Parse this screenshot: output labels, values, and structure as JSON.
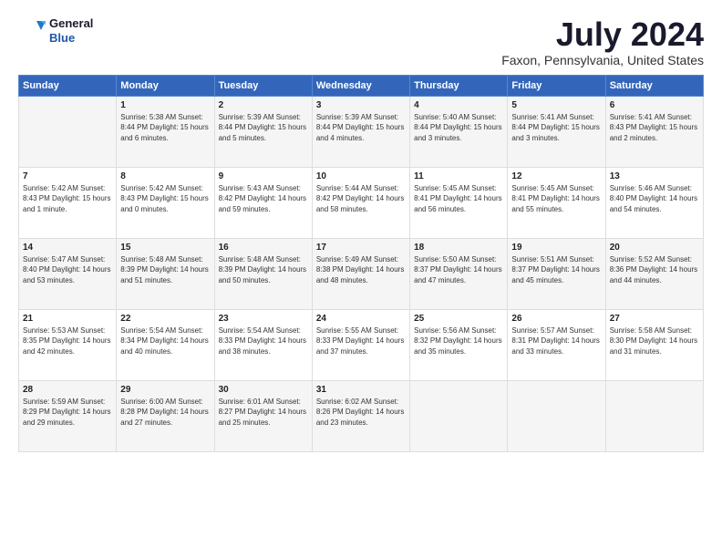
{
  "header": {
    "logo_general": "General",
    "logo_blue": "Blue",
    "month": "July 2024",
    "location": "Faxon, Pennsylvania, United States"
  },
  "days_of_week": [
    "Sunday",
    "Monday",
    "Tuesday",
    "Wednesday",
    "Thursday",
    "Friday",
    "Saturday"
  ],
  "weeks": [
    [
      {
        "day": "",
        "content": ""
      },
      {
        "day": "1",
        "content": "Sunrise: 5:38 AM\nSunset: 8:44 PM\nDaylight: 15 hours\nand 6 minutes."
      },
      {
        "day": "2",
        "content": "Sunrise: 5:39 AM\nSunset: 8:44 PM\nDaylight: 15 hours\nand 5 minutes."
      },
      {
        "day": "3",
        "content": "Sunrise: 5:39 AM\nSunset: 8:44 PM\nDaylight: 15 hours\nand 4 minutes."
      },
      {
        "day": "4",
        "content": "Sunrise: 5:40 AM\nSunset: 8:44 PM\nDaylight: 15 hours\nand 3 minutes."
      },
      {
        "day": "5",
        "content": "Sunrise: 5:41 AM\nSunset: 8:44 PM\nDaylight: 15 hours\nand 3 minutes."
      },
      {
        "day": "6",
        "content": "Sunrise: 5:41 AM\nSunset: 8:43 PM\nDaylight: 15 hours\nand 2 minutes."
      }
    ],
    [
      {
        "day": "7",
        "content": "Sunrise: 5:42 AM\nSunset: 8:43 PM\nDaylight: 15 hours\nand 1 minute."
      },
      {
        "day": "8",
        "content": "Sunrise: 5:42 AM\nSunset: 8:43 PM\nDaylight: 15 hours\nand 0 minutes."
      },
      {
        "day": "9",
        "content": "Sunrise: 5:43 AM\nSunset: 8:42 PM\nDaylight: 14 hours\nand 59 minutes."
      },
      {
        "day": "10",
        "content": "Sunrise: 5:44 AM\nSunset: 8:42 PM\nDaylight: 14 hours\nand 58 minutes."
      },
      {
        "day": "11",
        "content": "Sunrise: 5:45 AM\nSunset: 8:41 PM\nDaylight: 14 hours\nand 56 minutes."
      },
      {
        "day": "12",
        "content": "Sunrise: 5:45 AM\nSunset: 8:41 PM\nDaylight: 14 hours\nand 55 minutes."
      },
      {
        "day": "13",
        "content": "Sunrise: 5:46 AM\nSunset: 8:40 PM\nDaylight: 14 hours\nand 54 minutes."
      }
    ],
    [
      {
        "day": "14",
        "content": "Sunrise: 5:47 AM\nSunset: 8:40 PM\nDaylight: 14 hours\nand 53 minutes."
      },
      {
        "day": "15",
        "content": "Sunrise: 5:48 AM\nSunset: 8:39 PM\nDaylight: 14 hours\nand 51 minutes."
      },
      {
        "day": "16",
        "content": "Sunrise: 5:48 AM\nSunset: 8:39 PM\nDaylight: 14 hours\nand 50 minutes."
      },
      {
        "day": "17",
        "content": "Sunrise: 5:49 AM\nSunset: 8:38 PM\nDaylight: 14 hours\nand 48 minutes."
      },
      {
        "day": "18",
        "content": "Sunrise: 5:50 AM\nSunset: 8:37 PM\nDaylight: 14 hours\nand 47 minutes."
      },
      {
        "day": "19",
        "content": "Sunrise: 5:51 AM\nSunset: 8:37 PM\nDaylight: 14 hours\nand 45 minutes."
      },
      {
        "day": "20",
        "content": "Sunrise: 5:52 AM\nSunset: 8:36 PM\nDaylight: 14 hours\nand 44 minutes."
      }
    ],
    [
      {
        "day": "21",
        "content": "Sunrise: 5:53 AM\nSunset: 8:35 PM\nDaylight: 14 hours\nand 42 minutes."
      },
      {
        "day": "22",
        "content": "Sunrise: 5:54 AM\nSunset: 8:34 PM\nDaylight: 14 hours\nand 40 minutes."
      },
      {
        "day": "23",
        "content": "Sunrise: 5:54 AM\nSunset: 8:33 PM\nDaylight: 14 hours\nand 38 minutes."
      },
      {
        "day": "24",
        "content": "Sunrise: 5:55 AM\nSunset: 8:33 PM\nDaylight: 14 hours\nand 37 minutes."
      },
      {
        "day": "25",
        "content": "Sunrise: 5:56 AM\nSunset: 8:32 PM\nDaylight: 14 hours\nand 35 minutes."
      },
      {
        "day": "26",
        "content": "Sunrise: 5:57 AM\nSunset: 8:31 PM\nDaylight: 14 hours\nand 33 minutes."
      },
      {
        "day": "27",
        "content": "Sunrise: 5:58 AM\nSunset: 8:30 PM\nDaylight: 14 hours\nand 31 minutes."
      }
    ],
    [
      {
        "day": "28",
        "content": "Sunrise: 5:59 AM\nSunset: 8:29 PM\nDaylight: 14 hours\nand 29 minutes."
      },
      {
        "day": "29",
        "content": "Sunrise: 6:00 AM\nSunset: 8:28 PM\nDaylight: 14 hours\nand 27 minutes."
      },
      {
        "day": "30",
        "content": "Sunrise: 6:01 AM\nSunset: 8:27 PM\nDaylight: 14 hours\nand 25 minutes."
      },
      {
        "day": "31",
        "content": "Sunrise: 6:02 AM\nSunset: 8:26 PM\nDaylight: 14 hours\nand 23 minutes."
      },
      {
        "day": "",
        "content": ""
      },
      {
        "day": "",
        "content": ""
      },
      {
        "day": "",
        "content": ""
      }
    ]
  ]
}
